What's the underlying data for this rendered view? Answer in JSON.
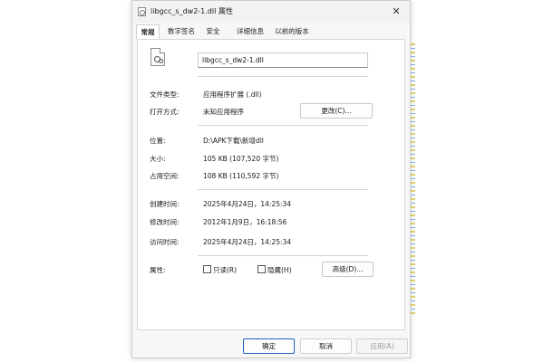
{
  "window": {
    "title": "libgcc_s_dw2-1.dll 属性",
    "close_glyph": "✕"
  },
  "tabs": [
    {
      "label": "常规",
      "active": true
    },
    {
      "label": "数字签名",
      "active": false
    },
    {
      "label": "安全",
      "active": false
    },
    {
      "label": "详细信息",
      "active": false
    },
    {
      "label": "以前的版本",
      "active": false
    }
  ],
  "general": {
    "file_name": "libgcc_s_dw2-1.dll",
    "file_type_label": "文件类型:",
    "file_type_value": "应用程序扩展 (.dll)",
    "opens_with_label": "打开方式:",
    "opens_with_value": "未知应用程序",
    "change_button": "更改(C)...",
    "location_label": "位置:",
    "location_value": "D:\\APK下载\\新增dll",
    "size_label": "大小:",
    "size_value": "105 KB (107,520 字节)",
    "size_on_disk_label": "占用空间:",
    "size_on_disk_value": "108 KB (110,592 字节)",
    "created_label": "创建时间:",
    "created_value": "2025年4月24日，14:25:34",
    "modified_label": "修改时间:",
    "modified_value": "2012年1月9日，16:18:56",
    "accessed_label": "访问时间:",
    "accessed_value": "2025年4月24日，14:25:34",
    "attributes_label": "属性:",
    "readonly_label": "只读(R)",
    "readonly_checked": false,
    "hidden_label": "隐藏(H)",
    "hidden_checked": false,
    "advanced_button": "高级(D)..."
  },
  "footer": {
    "ok": "确定",
    "cancel": "取消",
    "apply": "应用(A)"
  },
  "colors": {
    "primary_border": "#1f5fbf",
    "disabled_text": "#9a9a9a"
  }
}
